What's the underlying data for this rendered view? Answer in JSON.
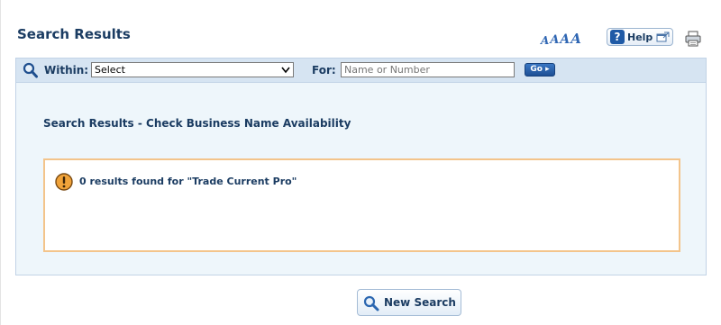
{
  "page": {
    "title": "Search Results"
  },
  "tools": {
    "font_size_glyphs": [
      "A",
      "A",
      "A",
      "A"
    ],
    "help_label": "Help",
    "help_icon": "question-mark-icon",
    "external_icon": "external-window-icon",
    "print_icon": "printer-icon"
  },
  "search_bar": {
    "within_label": "Within:",
    "within_selected": "Select",
    "for_label": "For:",
    "for_placeholder": "Name or Number",
    "go_label": "Go",
    "search_icon": "magnifier-icon"
  },
  "results": {
    "heading": "Search Results - Check Business Name Availability",
    "notice_icon": "warning-icon",
    "notice_text": "0 results found for \"Trade Current Pro\""
  },
  "actions": {
    "new_search_label": "New Search",
    "new_search_icon": "magnifier-icon"
  },
  "colors": {
    "heading_text": "#1b3c62",
    "search_bar_bg": "#d6e4f2",
    "panel_bg": "#eef6fb",
    "notice_border": "#f3c48b",
    "go_button": "#2a63ad",
    "warning": "#f0a33a"
  }
}
